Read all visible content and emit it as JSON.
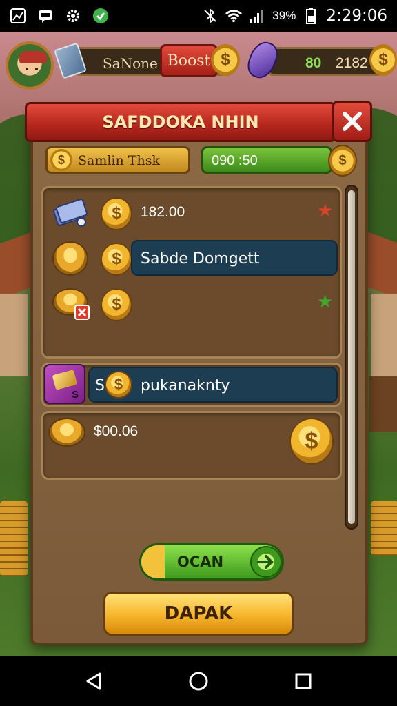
{
  "status_bar": {
    "time": "2:29:06",
    "battery_text": "39%",
    "icons": [
      "image-icon",
      "chat-icon",
      "gear-icon",
      "check-badge-icon",
      "bluetooth-off-icon",
      "wifi-icon",
      "signal-icon",
      "battery-icon"
    ]
  },
  "hud": {
    "profile_label": "SaNone",
    "boost_label": "Boost",
    "gems_value": "80",
    "coins_value": "2182"
  },
  "modal": {
    "title": "SAFDDOKA NHIN",
    "left_pill_label": "Samlin Thsk",
    "right_pill_value": "090 :50",
    "rows": [
      {
        "text": "182.00"
      },
      {
        "text": "Sabde Domgett"
      },
      {
        "text": ""
      }
    ],
    "special_row_label": "pukanaknty",
    "special_row_prefix": "S",
    "purple_icon_text": "S",
    "bottom_row_value": "$00.06",
    "green_button_label": "OCAN",
    "yellow_button_label": "DAPAK"
  },
  "colors": {
    "header_red": "#c0281e",
    "green_accent": "#3e9a1c",
    "teal_bar": "#1d3e52",
    "gold": "#f1b52e"
  }
}
